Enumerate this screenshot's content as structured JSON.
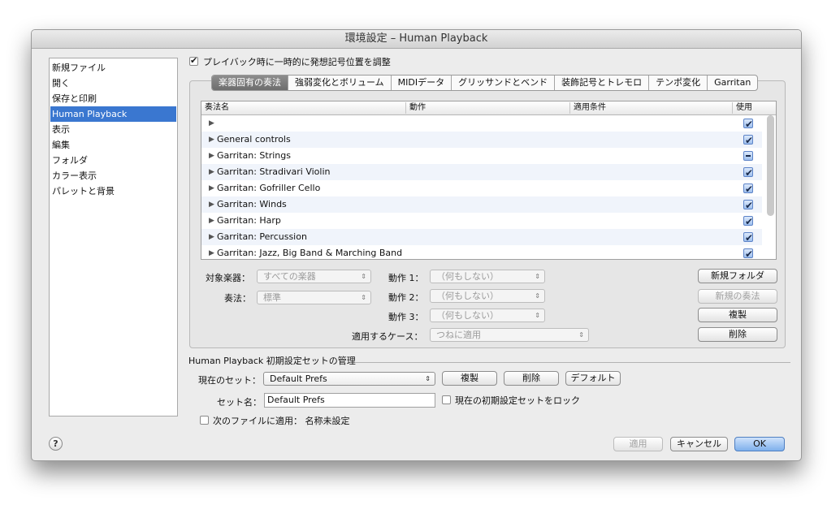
{
  "window": {
    "title": "環境設定 – Human Playback"
  },
  "sidebar": {
    "items": [
      {
        "label": "新規ファイル"
      },
      {
        "label": "開く"
      },
      {
        "label": "保存と印刷"
      },
      {
        "label": "Human Playback"
      },
      {
        "label": "表示"
      },
      {
        "label": "編集"
      },
      {
        "label": "フォルダ"
      },
      {
        "label": "カラー表示"
      },
      {
        "label": "パレットと背景"
      }
    ],
    "selected": "Human Playback"
  },
  "top_checkbox": {
    "label": "プレイバック時に一時的に発想記号位置を調整",
    "checked": true
  },
  "tabs": [
    {
      "label": "楽器固有の奏法",
      "active": true
    },
    {
      "label": "強弱変化とボリューム"
    },
    {
      "label": "MIDIデータ"
    },
    {
      "label": "グリッサンドとベンド"
    },
    {
      "label": "装飾記号とトレモロ"
    },
    {
      "label": "テンポ変化"
    },
    {
      "label": "Garritan"
    }
  ],
  "table": {
    "columns": [
      "奏法名",
      "動作",
      "適用条件",
      "使用"
    ],
    "rows": [
      {
        "name": "",
        "state": "checked"
      },
      {
        "name": "General controls",
        "state": "checked"
      },
      {
        "name": "Garritan: Strings",
        "state": "mixed"
      },
      {
        "name": "Garritan: Stradivari Violin",
        "state": "checked"
      },
      {
        "name": "Garritan: Gofriller Cello",
        "state": "checked"
      },
      {
        "name": "Garritan: Winds",
        "state": "checked"
      },
      {
        "name": "Garritan: Harp",
        "state": "checked"
      },
      {
        "name": "Garritan: Percussion",
        "state": "checked"
      },
      {
        "name": "Garritan: Jazz, Big Band & Marching Band",
        "state": "checked"
      }
    ]
  },
  "form": {
    "target_label": "対象楽器：",
    "target_value": "すべての楽器",
    "technique_label": "奏法：",
    "technique_value": "標準",
    "action1_label": "動作 1：",
    "action1_value": "（何もしない）",
    "action2_label": "動作 2：",
    "action2_value": "（何もしない）",
    "action3_label": "動作 3：",
    "action3_value": "（何もしない）",
    "case_label": "適用するケース：",
    "case_value": "つねに適用"
  },
  "right_buttons": {
    "new_folder": "新規フォルダ",
    "new_technique": "新規の奏法",
    "duplicate": "複製",
    "delete": "削除"
  },
  "presets": {
    "section_title": "Human Playback 初期設定セットの管理",
    "current_set_label": "現在のセット：",
    "current_set_value": "Default Prefs",
    "duplicate": "複製",
    "delete": "削除",
    "default": "デフォルト",
    "set_name_label": "セット名：",
    "set_name_value": "Default Prefs",
    "lock_label": "現在の初期設定セットをロック",
    "apply_next_label": "次のファイルに適用： 名称未設定"
  },
  "footer": {
    "help": "?",
    "apply": "適用",
    "cancel": "キャンセル",
    "ok": "OK"
  }
}
